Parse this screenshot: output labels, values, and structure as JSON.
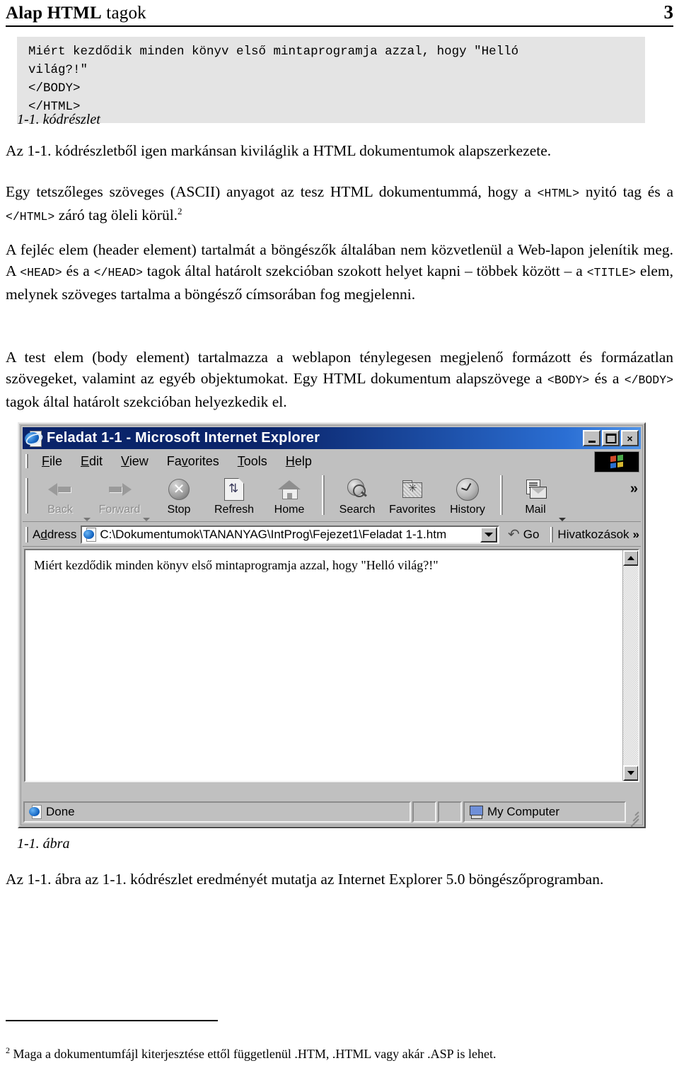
{
  "header": {
    "title_bold": "Alap HTML",
    "title_rest": " tagok",
    "page_number": "3"
  },
  "code_block": {
    "text": "Miért kezdődik minden könyv első mintaprogramja azzal, hogy \"Helló\nvilág?!\"\n</BODY>\n</HTML>",
    "caption": "1-1. kódrészlet"
  },
  "paragraphs": {
    "p1": "Az 1-1. kódrészletből igen markánsan kiviláglik a HTML dokumentumok alapszerkezete.",
    "p2_a": "Egy tetszőleges szöveges (ASCII) anyagot az tesz HTML dokumentummá, hogy a ",
    "p2_tag1": "<HTML>",
    "p2_b": " nyitó tag és a ",
    "p2_tag2": "</HTML>",
    "p2_c": " záró tag öleli körül.",
    "p2_footnote_marker": "2",
    "p3_a": "A fejléc elem (header element) tartalmát a böngészők általában nem közvetlenül a Web-lapon jelenítik meg. A ",
    "p3_tag1": "<HEAD>",
    "p3_b": " és a ",
    "p3_tag2": "</HEAD>",
    "p3_c": " tagok által határolt szekcióban szokott helyet kapni – többek között – a ",
    "p3_tag3": "<TITLE>",
    "p3_d": " elem, melynek szöveges tartalma a böngésző címsorában fog megjelenni.",
    "p4_a": "A test elem (body element) tartalmazza a weblapon ténylegesen megjelenő formázott és formázatlan szövegeket, valamint az egyéb objektumokat. Egy HTML dokumentum alapszövege a ",
    "p4_tag1": "<BODY>",
    "p4_b": " és a ",
    "p4_tag2": "</BODY>",
    "p4_c": " tagok által határolt szekcióban helyezkedik el.",
    "p5": "Az 1-1. ábra az 1-1. kódrészlet eredményét mutatja az Internet Explorer 5.0 böngészőprogramban."
  },
  "figure": {
    "caption": "1-1. ábra"
  },
  "browser": {
    "title": "Feladat 1-1 - Microsoft Internet Explorer",
    "window_buttons": {
      "minimize": "minimize-button",
      "maximize": "maximize-button",
      "close": "×"
    },
    "menu": [
      {
        "pre": "",
        "key": "F",
        "post": "ile"
      },
      {
        "pre": "",
        "key": "E",
        "post": "dit"
      },
      {
        "pre": "",
        "key": "V",
        "post": "iew"
      },
      {
        "pre": "Fa",
        "key": "v",
        "post": "orites"
      },
      {
        "pre": "",
        "key": "T",
        "post": "ools"
      },
      {
        "pre": "",
        "key": "H",
        "post": "elp"
      }
    ],
    "toolbar": [
      {
        "label": "Back",
        "icon": "back-arrow-icon",
        "disabled": true,
        "has_caret": true
      },
      {
        "label": "Forward",
        "icon": "forward-arrow-icon",
        "disabled": true,
        "has_caret": true
      },
      {
        "label": "Stop",
        "icon": "stop-icon",
        "disabled": false,
        "has_caret": false
      },
      {
        "label": "Refresh",
        "icon": "refresh-icon",
        "disabled": false,
        "has_caret": false
      },
      {
        "label": "Home",
        "icon": "home-icon",
        "disabled": false,
        "has_caret": false
      },
      {
        "label": "Search",
        "icon": "search-icon",
        "disabled": false,
        "has_caret": false
      },
      {
        "label": "Favorites",
        "icon": "favorites-folder-icon",
        "disabled": false,
        "has_caret": false
      },
      {
        "label": "History",
        "icon": "history-clock-icon",
        "disabled": false,
        "has_caret": false
      },
      {
        "label": "Mail",
        "icon": "mail-icon",
        "disabled": false,
        "has_caret": true
      }
    ],
    "toolbar_overflow": "»",
    "address": {
      "label_pre": "A",
      "label_key": "d",
      "label_post": "dress",
      "value": "C:\\Dokumentumok\\TANANYAG\\IntProg\\Fejezet1\\Feladat 1-1.htm",
      "go_label": "Go",
      "links_label": "Hivatkozások",
      "links_overflow": "»"
    },
    "page_content": "Miért kezdődik minden könyv első mintaprogramja azzal, hogy \"Helló világ?!\"",
    "status": {
      "left": "Done",
      "zone": "My Computer"
    }
  },
  "footnote": {
    "marker": "2",
    "text": " Maga a dokumentumfájl kiterjesztése ettől függetlenül .HTM, .HTML vagy akár .ASP is lehet."
  },
  "colors": {
    "code_bg": "#e4e4e4",
    "titlebar_start": "#0a246a",
    "titlebar_end": "#4f93e8",
    "window_face": "#c0c0c0"
  }
}
